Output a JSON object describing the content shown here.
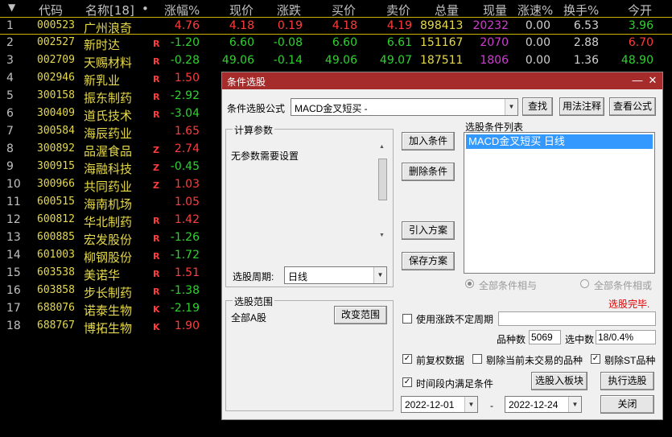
{
  "header": {
    "sort_icon": "sort-down-icon",
    "columns": [
      "代码",
      "名称[18]",
      "•",
      "涨幅%",
      "现价",
      "涨跌",
      "买价",
      "卖价",
      "总量",
      "现量",
      "涨速%",
      "换手%",
      "今开"
    ]
  },
  "rows": [
    {
      "no": "1",
      "code": "000523",
      "name": "广州浪奇",
      "mark": "",
      "chg_pct": "4.76",
      "price": "4.18",
      "chg": "0.19",
      "bid": "4.18",
      "ask": "4.19",
      "vol": "898413",
      "cur": "20232",
      "speed": "0.00",
      "turn": "6.53",
      "open": "3.96"
    },
    {
      "no": "2",
      "code": "002527",
      "name": "新时达",
      "mark": "R",
      "chg_pct": "-1.20",
      "price": "6.60",
      "chg": "-0.08",
      "bid": "6.60",
      "ask": "6.61",
      "vol": "151167",
      "cur": "2070",
      "speed": "0.00",
      "turn": "2.88",
      "open": "6.70"
    },
    {
      "no": "3",
      "code": "002709",
      "name": "天赐材料",
      "mark": "R",
      "chg_pct": "-0.28",
      "price": "49.06",
      "chg": "-0.14",
      "bid": "49.06",
      "ask": "49.07",
      "vol": "187511",
      "cur": "1806",
      "speed": "0.00",
      "turn": "1.36",
      "open": "48.90"
    },
    {
      "no": "4",
      "code": "002946",
      "name": "新乳业",
      "mark": "R",
      "chg_pct": "1.50"
    },
    {
      "no": "5",
      "code": "300158",
      "name": "振东制药",
      "mark": "R",
      "chg_pct": "-2.92"
    },
    {
      "no": "6",
      "code": "300409",
      "name": "道氏技术",
      "mark": "R",
      "chg_pct": "-3.04"
    },
    {
      "no": "7",
      "code": "300584",
      "name": "海辰药业",
      "mark": "",
      "chg_pct": "1.65"
    },
    {
      "no": "8",
      "code": "300892",
      "name": "品渥食品",
      "mark": "Z",
      "chg_pct": "2.74"
    },
    {
      "no": "9",
      "code": "300915",
      "name": "海融科技",
      "mark": "Z",
      "chg_pct": "-0.45"
    },
    {
      "no": "10",
      "code": "300966",
      "name": "共同药业",
      "mark": "Z",
      "chg_pct": "1.03"
    },
    {
      "no": "11",
      "code": "600515",
      "name": "海南机场",
      "mark": "",
      "chg_pct": "1.05"
    },
    {
      "no": "12",
      "code": "600812",
      "name": "华北制药",
      "mark": "R",
      "chg_pct": "1.42"
    },
    {
      "no": "13",
      "code": "600885",
      "name": "宏发股份",
      "mark": "R",
      "chg_pct": "-1.26"
    },
    {
      "no": "14",
      "code": "601003",
      "name": "柳钢股份",
      "mark": "R",
      "chg_pct": "-1.72"
    },
    {
      "no": "15",
      "code": "603538",
      "name": "美诺华",
      "mark": "R",
      "chg_pct": "1.51"
    },
    {
      "no": "16",
      "code": "603858",
      "name": "步长制药",
      "mark": "R",
      "chg_pct": "-1.38"
    },
    {
      "no": "17",
      "code": "688076",
      "name": "诺泰生物",
      "mark": "K",
      "chg_pct": "-2.19"
    },
    {
      "no": "18",
      "code": "688767",
      "name": "博拓生物",
      "mark": "K",
      "chg_pct": "1.90"
    }
  ],
  "dialog": {
    "title": "条件选股",
    "min_icon": "minimize-icon",
    "close_icon": "close-icon",
    "formula_label": "条件选股公式",
    "formula_value": "MACD金叉短买 -",
    "find_btn": "查找",
    "usage_btn": "用法注释",
    "view_formula_btn": "查看公式",
    "params_title": "计算参数",
    "params_text": "无参数需要设置",
    "period_label": "选股周期:",
    "period_value": "日线",
    "add_cond_btn": "加入条件",
    "del_cond_btn": "删除条件",
    "import_plan_btn": "引入方案",
    "save_plan_btn": "保存方案",
    "cond_list_title": "选股条件列表",
    "cond_list": [
      "MACD金叉短买  日线"
    ],
    "radio_and": "全部条件相与",
    "radio_or": "全部条件相或",
    "status": "选股完毕.",
    "range_title": "选股范围",
    "range_value": "全部A股",
    "change_range_btn": "改变范围",
    "use_irregular_label": "使用涨跌不定周期",
    "count_label": "品种数",
    "count_value": "5069",
    "selected_label": "选中数",
    "selected_value": "18/0.4%",
    "fq_label": "前复权数据",
    "exclude_untraded_label": "剔除当前未交易的品种",
    "exclude_st_label": "剔除ST品种",
    "time_cond_label": "时间段内满足条件",
    "to_block_btn": "选股入板块",
    "run_btn": "执行选股",
    "date_from": "2022-12-01",
    "date_sep": "-",
    "date_to": "2022-12-24",
    "close_btn": "关闭",
    "checks": {
      "use_irregular": false,
      "fq": true,
      "exclude_untraded": false,
      "exclude_st": true,
      "time_cond": true
    }
  }
}
